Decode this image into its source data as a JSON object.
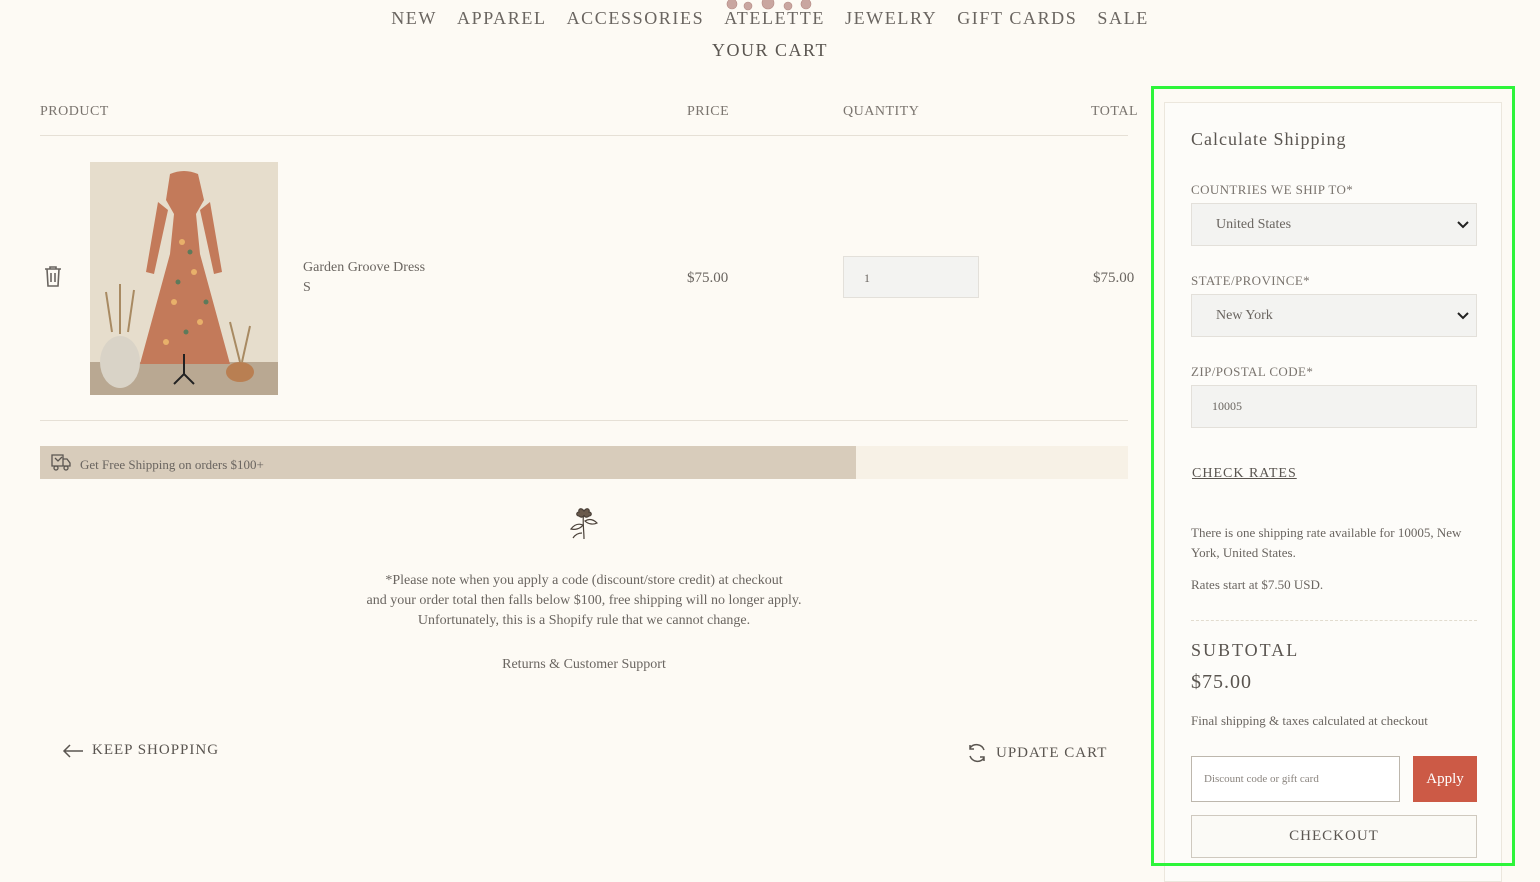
{
  "nav": {
    "items": [
      "NEW",
      "APPAREL",
      "ACCESSORIES",
      "ATELETTE",
      "JEWELRY",
      "GIFT CARDS",
      "SALE"
    ]
  },
  "cart": {
    "title": "YOUR CART",
    "headers": {
      "product": "PRODUCT",
      "price": "PRICE",
      "quantity": "QUANTITY",
      "total": "TOTAL"
    },
    "item": {
      "name": "Garden Groove Dress",
      "variant": "S",
      "price": "$75.00",
      "quantity": "1",
      "total": "$75.00"
    }
  },
  "shipping_bar": {
    "text": "Get Free Shipping on orders $100+",
    "progress_percent": 75
  },
  "note": {
    "line1": "*Please note when you apply a code (discount/store credit) at checkout",
    "line2": "and your order total then falls below $100, free shipping will no longer apply.",
    "line3": "Unfortunately, this is a Shopify rule that we cannot change.",
    "returns": "Returns & Customer Support"
  },
  "actions": {
    "keep_shopping": "KEEP SHOPPING",
    "update_cart": "UPDATE CART"
  },
  "sidebar": {
    "calc_title": "Calculate Shipping",
    "country_label": "COUNTRIES WE SHIP TO*",
    "country_value": "United States",
    "state_label": "STATE/PROVINCE*",
    "state_value": "New York",
    "zip_label": "ZIP/POSTAL CODE*",
    "zip_value": "10005",
    "check_rates": "CHECK RATES",
    "rate_text": "There is one shipping rate available for 10005, New York, United States.",
    "rate_start": "Rates start at $7.50 USD.",
    "subtotal_label": "SUBTOTAL",
    "subtotal_value": "$75.00",
    "final_note": "Final shipping & taxes calculated at checkout",
    "discount_placeholder": "Discount code or gift card",
    "apply_label": "Apply",
    "checkout_label": "CHECKOUT"
  },
  "colors": {
    "background": "#fdfaf4",
    "apply_button": "#cc5a46",
    "ship_bar_fill": "#d8ccbb",
    "highlight": "#2df53a"
  }
}
